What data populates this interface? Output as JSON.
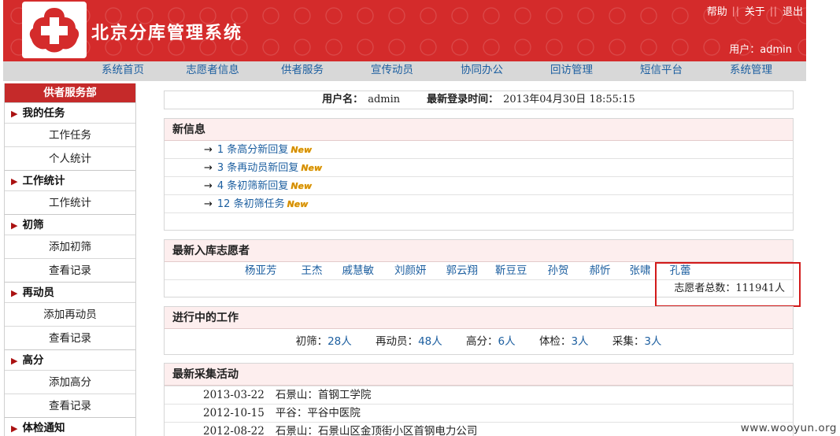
{
  "header": {
    "title": "北京分库管理系统",
    "links": [
      "帮助",
      "关于",
      "退出"
    ],
    "separator": "||",
    "user_label": "用户：",
    "user_name": "admin",
    "accent": "#d42b2b"
  },
  "nav": {
    "items": [
      "系统首页",
      "志愿者信息",
      "供者服务",
      "宣传动员",
      "协同办公",
      "回访管理",
      "短信平台",
      "系统管理"
    ]
  },
  "sidebar": {
    "title": "供者服务部",
    "groups": [
      {
        "label": "我的任务",
        "items": [
          "工作任务",
          "个人统计"
        ]
      },
      {
        "label": "工作统计",
        "items": [
          "工作统计"
        ]
      },
      {
        "label": "初筛",
        "items": [
          "添加初筛",
          "查看记录"
        ]
      },
      {
        "label": "再动员",
        "items": [
          "添加再动员",
          "查看记录"
        ]
      },
      {
        "label": "高分",
        "items": [
          "添加高分",
          "查看记录"
        ]
      },
      {
        "label": "体检通知",
        "items": []
      }
    ]
  },
  "user_info": {
    "user_label": "用户名：",
    "user_value": "admin",
    "login_label": "最新登录时间：",
    "login_value": "2013年04月30日 18:55:15"
  },
  "news": {
    "title": "新信息",
    "items": [
      "1 条高分新回复",
      "3 条再动员新回复",
      "4 条初筛新回复",
      "12 条初筛任务"
    ],
    "arrow": "→",
    "badge": "New"
  },
  "volunteers": {
    "title": "最新入库志愿者",
    "names": [
      "杨亚芳",
      "王杰",
      "戚慧敏",
      "刘颜妍",
      "郭云翔",
      "靳豆豆",
      "孙贺",
      "郝忻",
      "张啸",
      "孔蕾"
    ],
    "total_label": "志愿者总数：",
    "total_value": "111941人"
  },
  "work": {
    "title": "进行中的工作",
    "items": [
      {
        "label": "初筛：",
        "value": "28人"
      },
      {
        "label": "再动员：",
        "value": "48人"
      },
      {
        "label": "高分：",
        "value": "6人"
      },
      {
        "label": "体检：",
        "value": "3人"
      },
      {
        "label": "采集：",
        "value": "3人"
      }
    ]
  },
  "activities": {
    "title": "最新采集活动",
    "rows": [
      {
        "date": "2013-03-22",
        "text": "石景山：首钢工学院"
      },
      {
        "date": "2012-10-15",
        "text": "平谷：平谷中医院"
      },
      {
        "date": "2012-08-22",
        "text": "石景山：石景山区金顶街小区首钢电力公司"
      }
    ]
  },
  "watermark": "www.wooyun.org"
}
